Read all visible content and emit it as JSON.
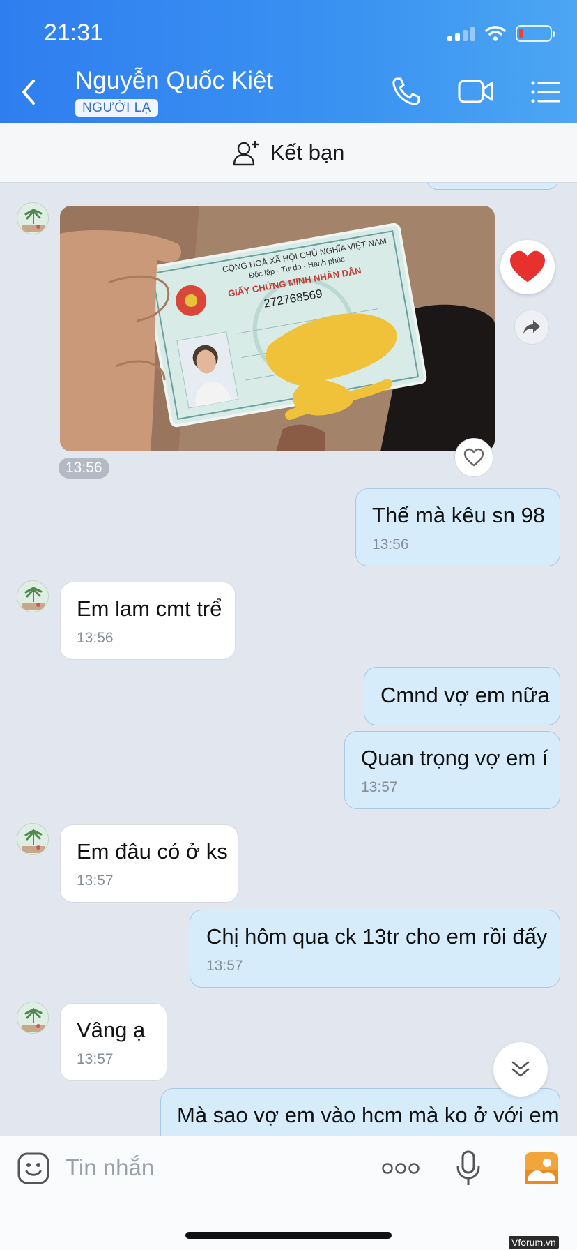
{
  "status_bar": {
    "time": "21:31"
  },
  "header": {
    "name": "Nguyễn Quốc Kiệt",
    "badge": "NGƯỜI LẠ"
  },
  "add_friend": {
    "label": "Kết bạn"
  },
  "photo": {
    "timestamp": "13:56",
    "card_number": "272768569",
    "card_title": "GIẤY CHỨNG MINH NHÂN DÂN"
  },
  "messages": [
    {
      "side": "out",
      "text": "Thế mà kêu sn 98",
      "time": "13:56"
    },
    {
      "side": "in",
      "text": "Em lam cmt trể",
      "time": "13:56"
    },
    {
      "side": "out",
      "text": "Cmnd vợ em nữa",
      "time": ""
    },
    {
      "side": "out",
      "text": "Quan trọng vợ em í",
      "time": "13:57"
    },
    {
      "side": "in",
      "text": "Em đâu có ở ks",
      "time": "13:57"
    },
    {
      "side": "out",
      "text": "Chị hôm qua ck 13tr cho em rồi đấy",
      "time": "13:57"
    },
    {
      "side": "in",
      "text": "Vâng ạ",
      "time": "13:57"
    },
    {
      "side": "out",
      "text": "Mà sao vợ em vào hcm mà ko ở với em",
      "time": ""
    }
  ],
  "composer": {
    "placeholder": "Tin nhắn"
  },
  "watermark": "Vforum.vn",
  "colors": {
    "header": "#2f7ef0",
    "outgoing_bubble": "#d6ecfb",
    "incoming_bubble": "#ffffff",
    "background": "#e2e6ee"
  }
}
